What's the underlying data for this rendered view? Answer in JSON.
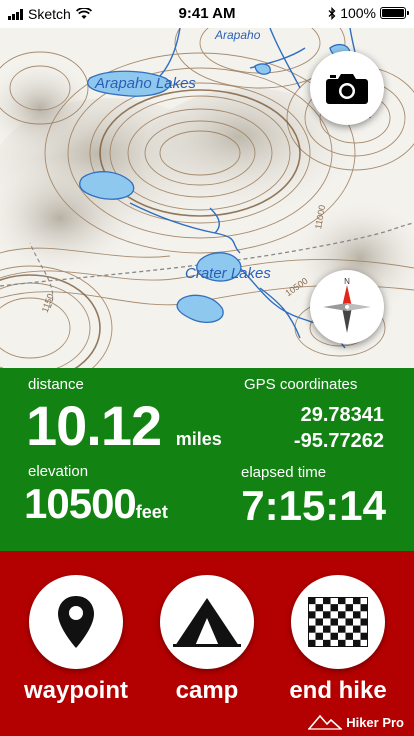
{
  "status_bar": {
    "carrier": "Sketch",
    "time": "9:41 AM",
    "battery_text": "100%",
    "battery_level": 1.0,
    "icons": [
      "signal-icon",
      "wifi-icon",
      "bluetooth-icon",
      "battery-icon"
    ]
  },
  "map": {
    "labels": {
      "arapaho_lakes": "Arapaho Lakes",
      "crater_lakes": "Crater Lakes",
      "arapaho_top": "Arapaho",
      "contour_10500": "10500",
      "contour_1150": "1150",
      "contour_11000": "11000"
    },
    "camera_icon": "camera-icon",
    "compass_icon": "compass-icon"
  },
  "stats": {
    "distance_label": "distance",
    "distance_value": "10.12",
    "distance_unit": "miles",
    "gps_label": "GPS coordinates",
    "latitude": "29.78341",
    "longitude": "-95.77262",
    "elevation_label": "elevation",
    "elevation_value": "10500",
    "elevation_unit": "feet",
    "elapsed_label": "elapsed time",
    "elapsed_value": "7:15:14"
  },
  "actions": {
    "waypoint_label": "waypoint",
    "camp_label": "camp",
    "end_hike_label": "end hike",
    "brand": "Hiker Pro"
  },
  "colors": {
    "stats_bg": "#128312",
    "actions_bg": "#b30000",
    "water": "#8ec8ef",
    "water_label": "#2b5fb4",
    "contour": "#8a6a4a"
  }
}
